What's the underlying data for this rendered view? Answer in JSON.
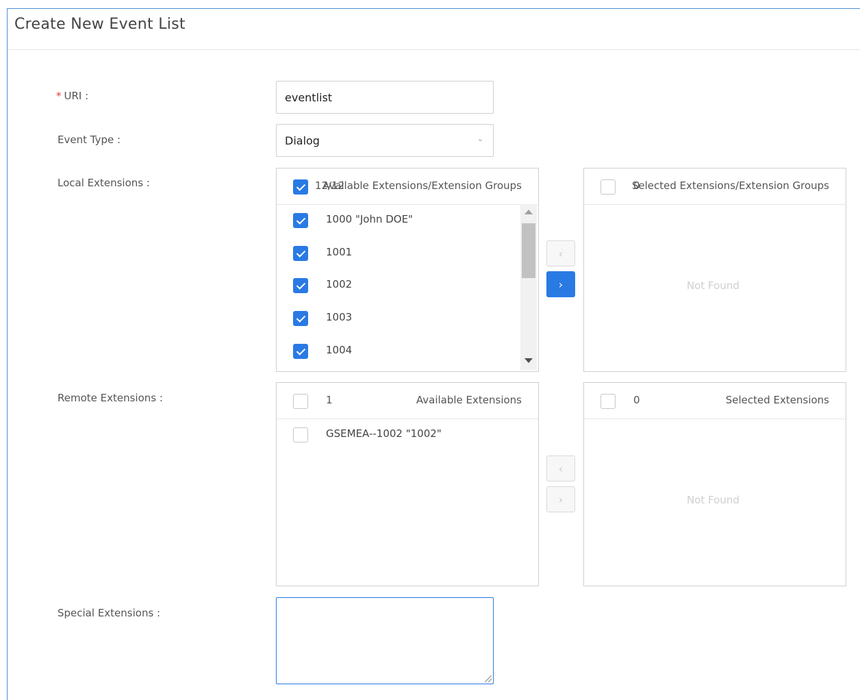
{
  "title": "Create New Event List",
  "form": {
    "uri": {
      "label": "URI",
      "required_mark": "*",
      "value": "eventlist"
    },
    "event_type": {
      "label": "Event Type",
      "value": "Dialog"
    },
    "local_extensions": {
      "label": "Local Extensions",
      "available": {
        "count": "12/12",
        "header": "Available Extensions/Extension Groups",
        "items": [
          "1000 \"John DOE\"",
          "1001",
          "1002",
          "1003",
          "1004"
        ]
      },
      "selected": {
        "count": "0",
        "header": "Selected Extensions/Extension Groups",
        "empty": "Not Found"
      }
    },
    "remote_extensions": {
      "label": "Remote Extensions",
      "available": {
        "count": "1",
        "header": "Available Extensions",
        "items": [
          "GSEMEA--1002 \"1002\""
        ]
      },
      "selected": {
        "count": "0",
        "header": "Selected Extensions",
        "empty": "Not Found"
      }
    },
    "special_extensions": {
      "label": "Special Extensions",
      "value": ""
    }
  },
  "colors": {
    "accent": "#2a7ae4",
    "required": "#e23b3b"
  }
}
